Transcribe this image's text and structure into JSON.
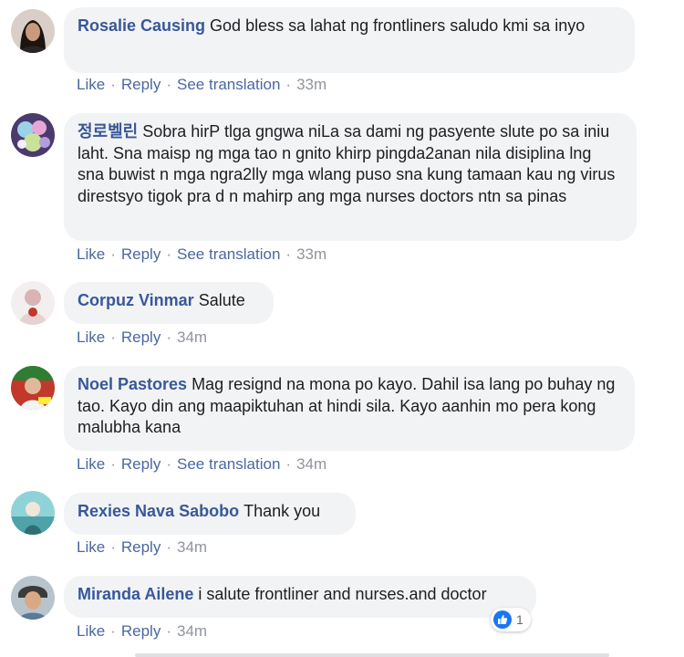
{
  "actions": {
    "like": "Like",
    "reply": "Reply",
    "see_translation": "See translation",
    "separator": "·"
  },
  "colors": {
    "author": "#385898",
    "action_link": "#4b67a1",
    "bubble": "#f2f3f5",
    "meta": "#90949c",
    "like_blue": "#1877f2"
  },
  "comments": [
    {
      "author": "Rosalie Causing",
      "text": "God bless sa lahat ng frontliners saludo kmi sa inyo",
      "time": "33m"
    },
    {
      "author": "정로벨린",
      "text": "Sobra hirP tlga gngwa niLa sa dami ng pasyente slute po sa iniu laht. Sna maisp ng mga tao n gnito khirp pingda2anan nila disiplina lng sna buwist n mga ngra2lly mga wlang puso sna kung tamaan kau ng virus direstsyo tigok pra d n mahirp ang mga nurses doctors ntn sa pinas",
      "time": "33m"
    },
    {
      "author": "Corpuz Vinmar",
      "text": "Salute",
      "time": "34m"
    },
    {
      "author": "Noel Pastores",
      "text": "Mag resignd na mona po kayo. Dahil isa lang po buhay ng tao. Kayo din ang maapiktuhan at hindi sila. Kayo aanhin mo pera kong malubha kana",
      "time": "34m"
    },
    {
      "author": "Rexies Nava Sabobo",
      "text": "Thank you",
      "time": "34m"
    },
    {
      "author": "Miranda Ailene",
      "text": "i salute frontliner and nurses.and doctor",
      "time": "34m",
      "reaction_icon": "like-thumb-icon",
      "reaction_count": "1"
    }
  ]
}
